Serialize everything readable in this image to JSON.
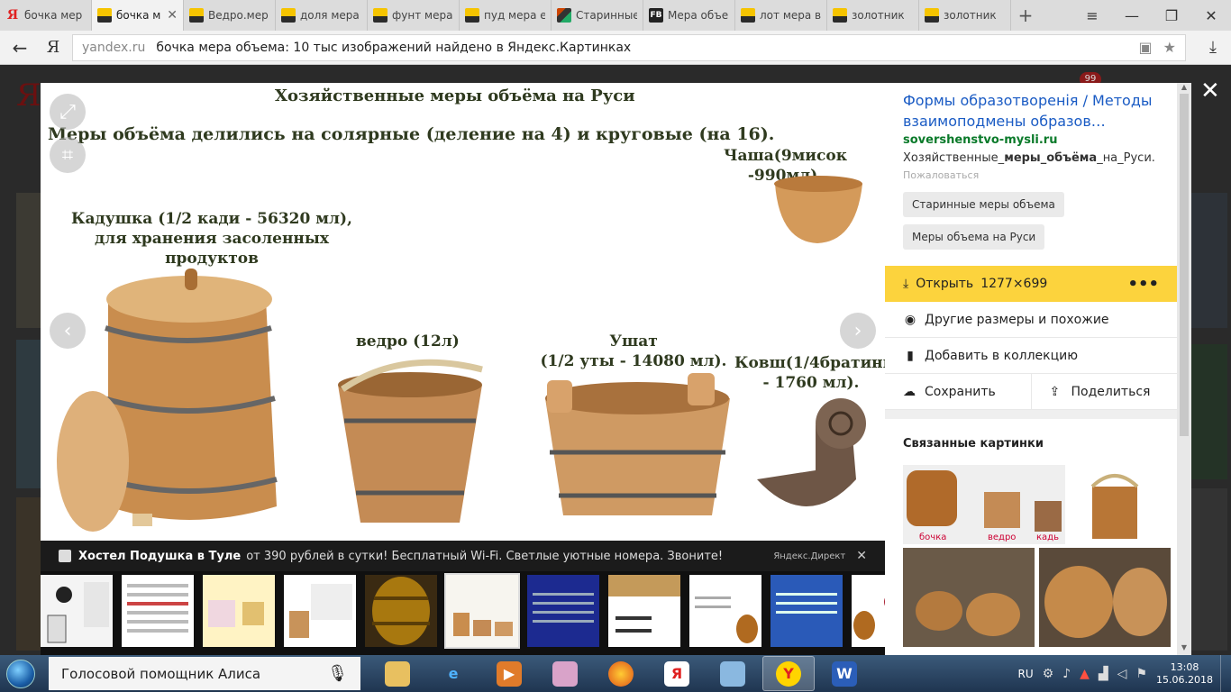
{
  "tabs": [
    {
      "label": "бочка мер",
      "icon": "yandex-icon",
      "active": false
    },
    {
      "label": "бочка м",
      "icon": "images-icon",
      "active": true
    },
    {
      "label": "Ведро.мер",
      "icon": "images-icon",
      "active": false
    },
    {
      "label": "доля мера",
      "icon": "images-icon",
      "active": false
    },
    {
      "label": "фунт мера",
      "icon": "images-icon",
      "active": false
    },
    {
      "label": "пуд мера е",
      "icon": "images-icon",
      "active": false
    },
    {
      "label": "Старинные",
      "icon": "site-icon",
      "active": false
    },
    {
      "label": "Мера объе",
      "icon": "fb-icon",
      "active": false
    },
    {
      "label": "лот мера в",
      "icon": "images-icon",
      "active": false
    },
    {
      "label": "золотник",
      "icon": "images-icon",
      "active": false
    },
    {
      "label": "золотник",
      "icon": "images-icon",
      "active": false
    }
  ],
  "fb_icon_text": "FB",
  "address": {
    "ya_logo": "Я",
    "domain": "yandex.ru",
    "title": "бочка мера объема: 10 тыс изображений найдено в Яндекс.Картинках"
  },
  "background": {
    "logo": "Я",
    "badge": "99"
  },
  "image": {
    "title": "Хозяйственные меры объёма на Руси",
    "subtitle": "Меры объёма делились на солярные (деление на 4) и круговые (на 16).",
    "caption_kadushka_1": "Кадушка (1/2 кади - 56320 мл),",
    "caption_kadushka_2": "для хранения засоленных продуктов",
    "caption_chasha": "Чаша(9мисок -990мл).",
    "caption_vedro": "ведро (12л)",
    "caption_ushat_1": "Ушат",
    "caption_ushat_2": "(1/2 уты - 14080 мл).",
    "caption_kovsh_1": "Ковш(1/4братины",
    "caption_kovsh_2": "- 1760 мл)."
  },
  "ad": {
    "title": "Хостел Подушка в Туле",
    "text": "от 390 рублей в сутки! Бесплатный Wi-Fi. Светлые уютные номера. Звоните!",
    "label": "Яндекс.Директ"
  },
  "sidebar": {
    "title": "Формы образотворенія / Методы взаимоподмены образов…",
    "domain": "sovershenstvo-mysli.ru",
    "snippet_pre": "Хозяйственные_",
    "snippet_bold": "меры_объёма",
    "snippet_post": "_на_Руси.",
    "complain": "Пожаловаться",
    "tag1": "Старинные меры объема",
    "tag2": "Меры объема на Руси",
    "open_label": "Открыть",
    "open_size": "1277×699",
    "open_more": "•••",
    "other_sizes": "Другие размеры и похожие",
    "add_collection": "Добавить в коллекцию",
    "save": "Сохранить",
    "share": "Поделиться",
    "related_title": "Связанные картинки",
    "related_labels": [
      "бочка",
      "ведро",
      "кадь"
    ]
  },
  "taskbar": {
    "alice": "Голосовой помощник Алиса",
    "lang": "RU",
    "time": "13:08",
    "date": "15.06.2018"
  },
  "colors": {
    "accent_yellow": "#fcd33d",
    "link_blue": "#1a5bc4",
    "domain_green": "#0a7a2a"
  }
}
